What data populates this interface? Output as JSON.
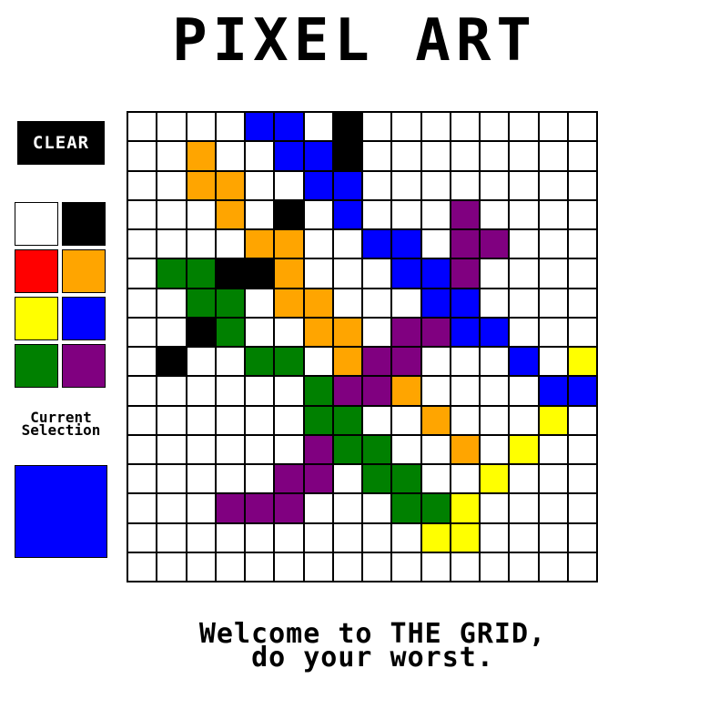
{
  "app": {
    "title": "PIXEL ART"
  },
  "toolbar": {
    "clear_label": "CLEAR"
  },
  "palette": {
    "colors": [
      {
        "name": "white",
        "hex": "#ffffff"
      },
      {
        "name": "black",
        "hex": "#000000"
      },
      {
        "name": "red",
        "hex": "#ff0000"
      },
      {
        "name": "orange",
        "hex": "#ffa500"
      },
      {
        "name": "yellow",
        "hex": "#ffff00"
      },
      {
        "name": "blue",
        "hex": "#0000ff"
      },
      {
        "name": "green",
        "hex": "#008000"
      },
      {
        "name": "purple",
        "hex": "#800080"
      }
    ]
  },
  "current_selection": {
    "label": "Current\nSelection",
    "color": "#0000ff"
  },
  "grid": {
    "legend": {
      ".": "#ffffff",
      "K": "#000000",
      "B": "#0000ff",
      "O": "#ffa500",
      "G": "#008000",
      "P": "#800080",
      "Y": "#ffff00"
    },
    "rows": [
      "....BB.K........",
      "..O..BBK........",
      "..OO..BB........",
      "...O.K.B...P....",
      "....OO..BB.PP...",
      ".GGKKO...BBP....",
      "..GG.OO...BB....",
      "..KG..OO.PPBB...",
      ".K..GG.OPP...B.Y",
      "......GPPO....BB",
      "......GG..O...Y.",
      "......PGG..O.Y..",
      ".....PP.GG..Y...",
      "...PPP...GGY....",
      "..........YY....",
      "................"
    ]
  },
  "footer": {
    "message": "Welcome to THE GRID,\ndo your worst."
  }
}
